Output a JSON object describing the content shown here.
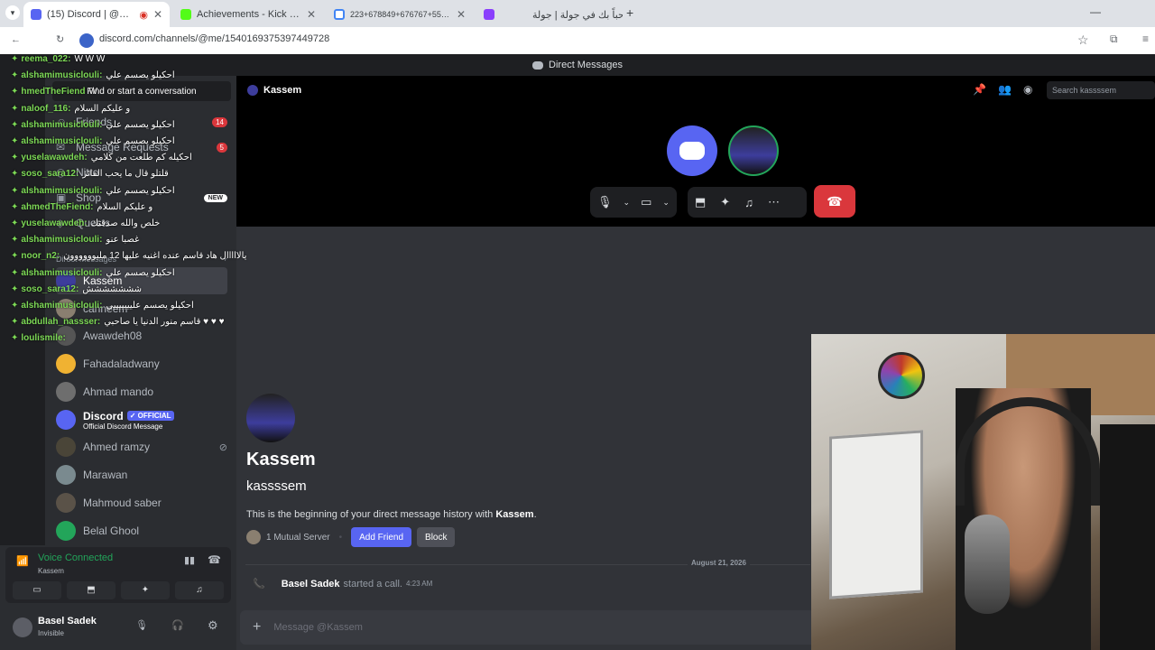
{
  "browser": {
    "tabs": [
      {
        "title": "(15) Discord | @Kassem",
        "active": true,
        "color": "#5865f2"
      },
      {
        "title": "Achievements - Kick Dashboard",
        "active": false,
        "color": "#53fc18"
      },
      {
        "title": "223+678849+676767+555 - Go",
        "active": false,
        "color": "#4285f4"
      },
      {
        "title": "مرحباً بك في جولة | جولة",
        "active": false,
        "color": "#8a3ffc"
      }
    ],
    "url": "discord.com/channels/@me/1540169375397449728"
  },
  "topbar": {
    "title": "Direct Messages"
  },
  "sidebar": {
    "search_placeholder": "Find or start a conversation",
    "nav": [
      {
        "label": "Friends",
        "badge": "14"
      },
      {
        "label": "Message Requests",
        "badge": "5"
      },
      {
        "label": "Nitro",
        "badge": ""
      },
      {
        "label": "Shop",
        "badge": "NEW"
      },
      {
        "label": "Quests",
        "badge": ""
      }
    ],
    "dm_header": "Direct Messages",
    "dms": [
      {
        "name": "Kassem",
        "active": true
      },
      {
        "name": "canneem",
        "active": false
      },
      {
        "name": "Awawdeh08",
        "active": false
      },
      {
        "name": "Fahadaladwany",
        "active": false
      },
      {
        "name": "Ahmad mando",
        "active": false
      },
      {
        "name": "Discord",
        "tag": "✓ OFFICIAL",
        "sub": "Official Discord Message",
        "active": false
      },
      {
        "name": "Ahmed ramzy",
        "active": false
      },
      {
        "name": "Marawan",
        "active": false
      },
      {
        "name": "Mahmoud saber",
        "active": false
      },
      {
        "name": "Belal Ghool",
        "active": false
      }
    ],
    "voice": {
      "status": "Voice Connected",
      "channel": "Kassem"
    },
    "user": {
      "name": "Basel Sadek",
      "status": "Invisible"
    }
  },
  "overlay_chat": [
    {
      "name": "reema_022:",
      "text": "W W W"
    },
    {
      "name": "alshamimusiclouli:",
      "text": "احكيلو يصسم علي"
    },
    {
      "name": "hmedTheFiend",
      "text": "W"
    },
    {
      "name": "naloof_116:",
      "text": "و عليكم السلام"
    },
    {
      "name": "alshamimusiclouli:",
      "text": "احكيلو يصسم علي"
    },
    {
      "name": "alshamimusiclouli:",
      "text": "احكيلو يصسم علي"
    },
    {
      "name": "yuselawawdeh:",
      "text": "احكيله كم طلعت من كلامي"
    },
    {
      "name": "soso_sara12:",
      "text": "قلتلو قال ما يحب الفائز"
    },
    {
      "name": "alshamimusiclouli:",
      "text": "احكيلو يصسم علي"
    },
    {
      "name": "ahmedTheFiend:",
      "text": "و عليكم السلام"
    },
    {
      "name": "yuselawawdeh:",
      "text": "خلص والله صدقتك"
    },
    {
      "name": "alshamimusiclouli:",
      "text": "غصبا عنو"
    },
    {
      "name": "noor_n2:",
      "text": "يالااااال هاد قاسم عنده اغنيه عليها 12 مليوووووون"
    },
    {
      "name": "alshamimusiclouli:",
      "text": "احكيلو يصسم علي"
    },
    {
      "name": "soso_sara12:",
      "text": "ششششششش"
    },
    {
      "name": "alshamimusiclouli:",
      "text": "احكيلو يصسم عليييييييي"
    },
    {
      "name": "abdullah_nassser:",
      "text": "قاسم منور الدنيا يا صاحبي ♥ ♥ ♥"
    },
    {
      "name": "loulismile:",
      "text": ""
    }
  ],
  "header": {
    "name": "Kassem",
    "search_placeholder": "Search kassssem"
  },
  "profile": {
    "display_name": "Kassem",
    "username": "kassssem",
    "intro_prefix": "This is the beginning of your direct message history with ",
    "intro_name": "Kassem",
    "mutual": "1 Mutual Server",
    "add_friend": "Add Friend",
    "block": "Block"
  },
  "messages": {
    "date_divider": "August 21, 2026",
    "call_user": "Basel Sadek",
    "call_text": "started a call.",
    "call_time": "4:23 AM",
    "composer_placeholder": "Message @Kassem"
  },
  "colors": {
    "blurple": "#5865f2",
    "hangup": "#da373c",
    "online": "#23a55a"
  }
}
